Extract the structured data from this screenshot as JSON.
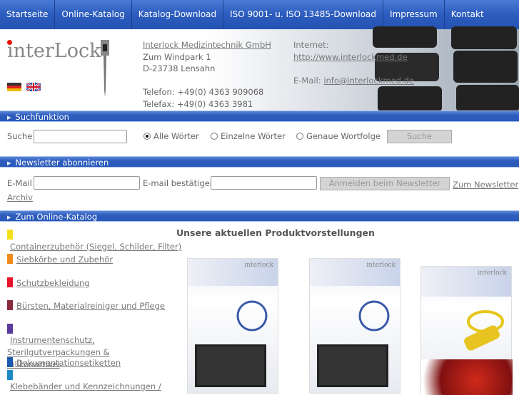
{
  "nav": [
    "Startseite",
    "Online-Katalog",
    "Katalog-Download",
    "ISO 9001- u. ISO 13485-Download",
    "Impressum",
    "Kontakt"
  ],
  "header": {
    "logo": "interLock",
    "company": "Interlock Medizintechnik GmbH",
    "street": "Zum Windpark 1",
    "city": "D-23738 Lensahn",
    "phone": "Telefon: +49(0) 4363 909068",
    "fax": "Telefax: +49(0) 4363 3981",
    "internet_label": "Internet:",
    "internet_url": "http://www.interlockmed.de",
    "email_label": "E-Mail:",
    "email": "info@interlockmed.de",
    "flags": [
      "german-flag",
      "english-flag"
    ]
  },
  "search": {
    "section": "Suchfunktion",
    "label": "Suche",
    "value": "",
    "options": [
      "Alle Wörter",
      "Einzelne Wörter",
      "Genaue Wortfolge"
    ],
    "selected": 0,
    "button": "Suche"
  },
  "newsletter": {
    "section": "Newsletter abonnieren",
    "email_label": "E-Mail",
    "confirm_label": "E-mail bestätigen",
    "button": "Anmelden beim Newsletter",
    "archive_link": "Zum Newsletter Archiv"
  },
  "catalog": {
    "section": "Zum Online-Katalog",
    "categories": [
      {
        "label": "Containerzubehör (Siegel, Schilder, Filter)",
        "color": "#f2e018"
      },
      {
        "label": "Siebkörbe und Zubehör",
        "color": "#f08a1c"
      },
      {
        "label": "Schutzbekleidung",
        "color": "#e8142c"
      },
      {
        "label": "Bürsten, Materialreiniger und Pflege",
        "color": "#8a2a3e"
      },
      {
        "label": "Instrumentenschutz, Sterilgutverpackungen & Silikonartikel",
        "color": "#5a3a9e"
      },
      {
        "label": "Dokumentationsetiketten",
        "color": "#1a5ab0"
      },
      {
        "label": "Klebebänder und Kennzeichnungen /",
        "color": "#1a8ac8"
      }
    ]
  },
  "products": {
    "title": "Unsere aktuellen Produktvorstellungen",
    "logo": "interlock"
  }
}
